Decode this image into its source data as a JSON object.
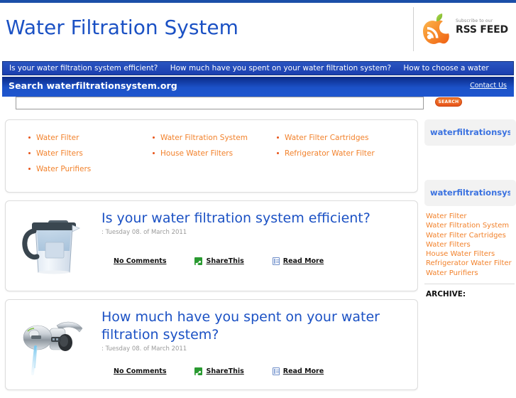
{
  "header": {
    "site_title": "Water Filtration System",
    "rss": {
      "subscribe_text": "Subscribe to our",
      "feed_text": "RSS FEED",
      "icon": "rss-apple-icon"
    }
  },
  "ticker": {
    "items": [
      "Is your water filtration system efficient?",
      "How much have you spent on your water filtration system?",
      "How to choose a water"
    ]
  },
  "search": {
    "label": "Search waterfiltrationsystem.org",
    "contact_label": "Contact Us",
    "input_value": "",
    "input_placeholder": "",
    "button_label": "SEARCH"
  },
  "keywords": {
    "columns": [
      [
        "Water Filter",
        "Water Filters",
        "Water Purifiers"
      ],
      [
        "Water Filtration System",
        "House Water Filters"
      ],
      [
        "Water Filter Cartridges",
        "Refrigerator Water Filter"
      ]
    ]
  },
  "articles": [
    {
      "title": "Is your water filtration system efficient?",
      "date": ": Tuesday 08. of March 2011",
      "thumb": "water-pitcher-filter-image",
      "actions": [
        {
          "label": "No Comments",
          "icon": ""
        },
        {
          "label": "ShareThis",
          "icon": "share-icon"
        },
        {
          "label": "Read More",
          "icon": "document-icon"
        }
      ]
    },
    {
      "title": "How much have you spent on your water filtration system?",
      "date": ": Tuesday 08. of March 2011",
      "thumb": "faucet-water-filter-image",
      "actions": [
        {
          "label": "No Comments",
          "icon": ""
        },
        {
          "label": "ShareThis",
          "icon": "share-icon"
        },
        {
          "label": "Read More",
          "icon": "document-icon"
        }
      ]
    }
  ],
  "sidebar": {
    "links_box_title": "waterfiltrationsyst Links",
    "categories_box_title": "waterfiltrationsyst Categories",
    "categories": [
      "Water Filter",
      "Water Filtration System",
      "Water Filter Cartridges",
      "Water Filters",
      "House Water Filters",
      "Refrigerator Water Filter",
      "Water Purifiers"
    ],
    "archive_label": "ARCHIVE:"
  },
  "colors": {
    "brand_blue": "#1b51c4",
    "nav_blue": "#1f56cf",
    "accent_orange": "#f2822c",
    "button_orange": "#e8541a",
    "share_green": "#2a9a31",
    "sidebar_bg": "#f2f2f2"
  }
}
